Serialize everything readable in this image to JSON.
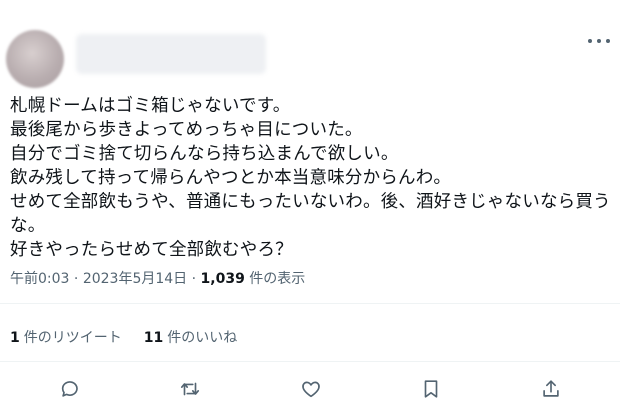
{
  "tweet": {
    "lines": [
      "札幌ドームはゴミ箱じゃないです。",
      "最後尾から歩きよってめっちゃ目についた。",
      "自分でゴミ捨て切らんなら持ち込まんで欲しい。",
      "飲み残して持って帰らんやつとか本当意味分からんわ。",
      "せめて全部飲もうや、普通にもったいないわ。後、酒好きじゃないなら買う",
      "な。",
      "好きやったらせめて全部飲むやろ？"
    ],
    "time": "午前0:03",
    "separator": "·",
    "date": "2023年5月14日",
    "views_count": "1,039",
    "views_label": "件の表示"
  },
  "stats": {
    "retweets_count": "1",
    "retweets_label": "件のリツイート",
    "likes_count": "11",
    "likes_label": "件のいいね"
  },
  "actions": {
    "icons": [
      "reply-icon",
      "retweet-icon",
      "like-icon",
      "bookmark-icon",
      "share-icon"
    ]
  },
  "colors": {
    "text": "#0f1419",
    "secondary": "#536471",
    "divider": "#eff3f4"
  }
}
